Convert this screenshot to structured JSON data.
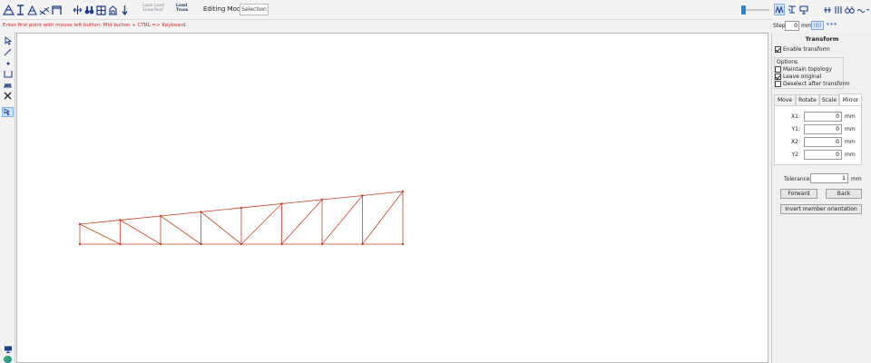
{
  "toolbar": {
    "icons": [
      "truss-icon",
      "column-icon",
      "triangle-truss-icon",
      "bracing-icon",
      "frame-icon",
      "move-node-icon",
      "binoculars-icon",
      "grid-icon",
      "support-icon",
      "load-icon"
    ],
    "load_buttons": [
      {
        "line1": "Load",
        "line2": "Snow"
      },
      {
        "line1": "Load",
        "line2": "Roof"
      },
      {
        "line1": "Load",
        "line2": "Truss"
      }
    ],
    "editing_mode_label": "Editing Mode:",
    "editing_mode_value": "Selection",
    "zoom_level": 0.1
  },
  "prompt": {
    "text": "Enter first point with mouse left button; Mid button + CTRL => Keyboard."
  },
  "left_tools": [
    "pointer-icon",
    "line-icon",
    "node-icon",
    "support-icon",
    "spring-icon",
    "delete-icon",
    "transform-icon"
  ],
  "step": {
    "label": "Step:",
    "value": "0",
    "unit": "mm",
    "btn1": "|||||",
    "btn2": "∗∗∗"
  },
  "panel": {
    "title": "Transform",
    "enable_transform_label": "Enable transform",
    "enable_transform_checked": true,
    "options_label": "Options",
    "options": [
      {
        "label": "Maintain topology",
        "checked": false
      },
      {
        "label": "Leave original",
        "checked": true
      },
      {
        "label": "Deselect after transform",
        "checked": false
      }
    ],
    "tabs": [
      {
        "label": "Move",
        "active": false
      },
      {
        "label": "Rotate",
        "active": false
      },
      {
        "label": "Scale",
        "active": false
      },
      {
        "label": "Mirror",
        "active": true
      }
    ],
    "coords": [
      {
        "label": "X1:",
        "value": "0",
        "unit": "mm"
      },
      {
        "label": "Y1:",
        "value": "0",
        "unit": "mm"
      },
      {
        "label": "X2:",
        "value": "0",
        "unit": "mm"
      },
      {
        "label": "Y2:",
        "value": "0",
        "unit": "mm"
      }
    ],
    "tolerance_label": "Tolerance:",
    "tolerance_value": "1",
    "tolerance_unit": "mm",
    "forward_label": "Forward",
    "back_label": "Back",
    "invert_label": "Invert member orientation"
  },
  "colors": {
    "truss": "#c8402a",
    "prompt": "#d42020",
    "accent": "#1e8ad8"
  }
}
